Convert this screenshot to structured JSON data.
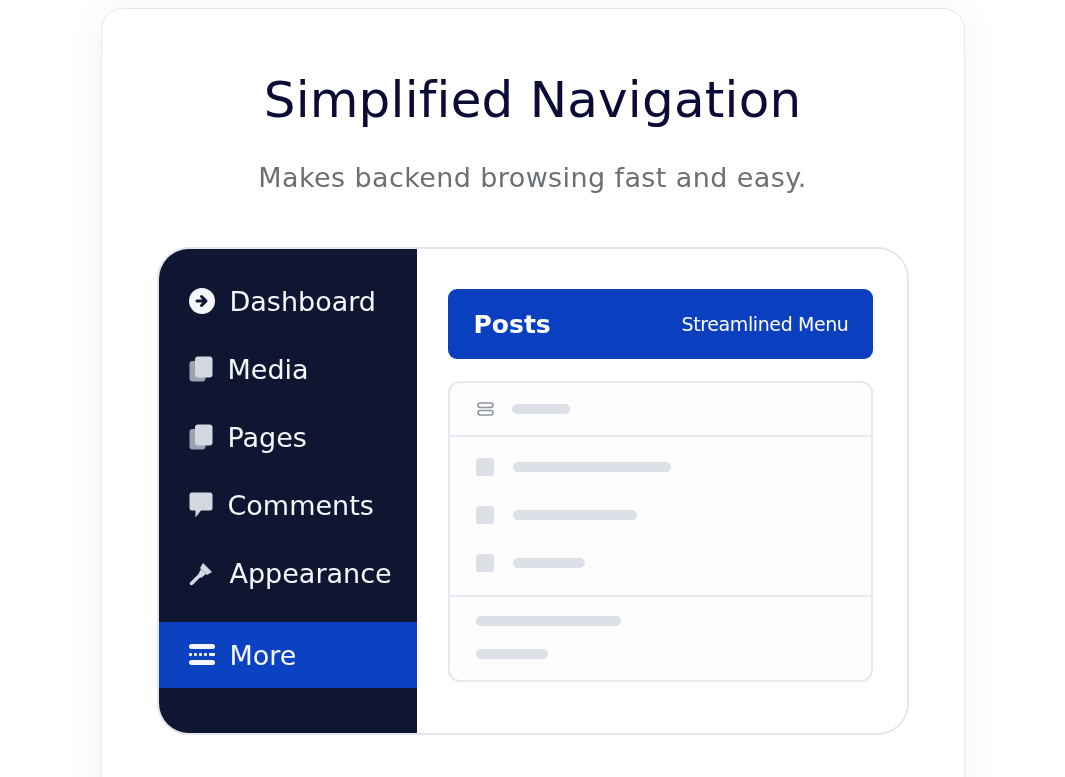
{
  "title": "Simplified Navigation",
  "subtitle": "Makes backend browsing fast and easy.",
  "mockup": {
    "sidebar": {
      "items": [
        {
          "label": "Dashboard",
          "selected": false
        },
        {
          "label": "Media",
          "selected": false
        },
        {
          "label": "Pages",
          "selected": false
        },
        {
          "label": "Comments",
          "selected": false
        },
        {
          "label": "Appearance",
          "selected": false
        },
        {
          "label": "More",
          "selected": true
        }
      ]
    },
    "header": {
      "title": "Posts",
      "caption": "Streamlined Menu"
    }
  }
}
